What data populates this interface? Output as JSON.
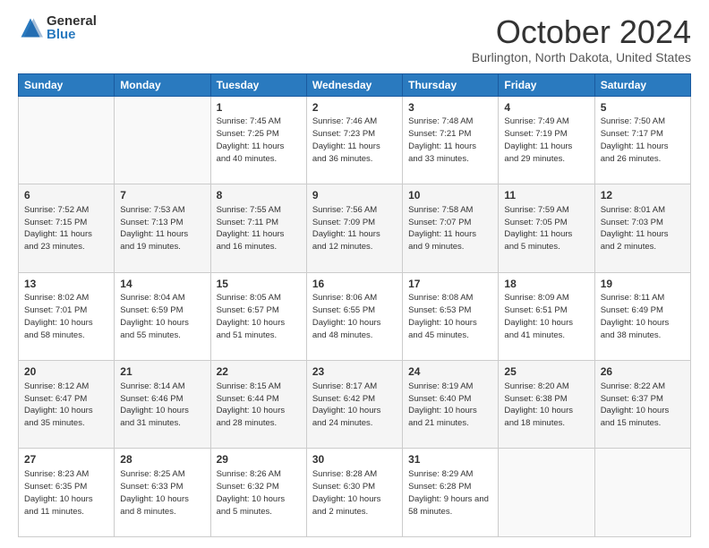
{
  "logo": {
    "general": "General",
    "blue": "Blue"
  },
  "title": "October 2024",
  "location": "Burlington, North Dakota, United States",
  "days_of_week": [
    "Sunday",
    "Monday",
    "Tuesday",
    "Wednesday",
    "Thursday",
    "Friday",
    "Saturday"
  ],
  "weeks": [
    [
      {
        "day": "",
        "info": "",
        "empty": true
      },
      {
        "day": "",
        "info": "",
        "empty": true
      },
      {
        "day": "1",
        "info": "Sunrise: 7:45 AM\nSunset: 7:25 PM\nDaylight: 11 hours and 40 minutes."
      },
      {
        "day": "2",
        "info": "Sunrise: 7:46 AM\nSunset: 7:23 PM\nDaylight: 11 hours and 36 minutes."
      },
      {
        "day": "3",
        "info": "Sunrise: 7:48 AM\nSunset: 7:21 PM\nDaylight: 11 hours and 33 minutes."
      },
      {
        "day": "4",
        "info": "Sunrise: 7:49 AM\nSunset: 7:19 PM\nDaylight: 11 hours and 29 minutes."
      },
      {
        "day": "5",
        "info": "Sunrise: 7:50 AM\nSunset: 7:17 PM\nDaylight: 11 hours and 26 minutes."
      }
    ],
    [
      {
        "day": "6",
        "info": "Sunrise: 7:52 AM\nSunset: 7:15 PM\nDaylight: 11 hours and 23 minutes."
      },
      {
        "day": "7",
        "info": "Sunrise: 7:53 AM\nSunset: 7:13 PM\nDaylight: 11 hours and 19 minutes."
      },
      {
        "day": "8",
        "info": "Sunrise: 7:55 AM\nSunset: 7:11 PM\nDaylight: 11 hours and 16 minutes."
      },
      {
        "day": "9",
        "info": "Sunrise: 7:56 AM\nSunset: 7:09 PM\nDaylight: 11 hours and 12 minutes."
      },
      {
        "day": "10",
        "info": "Sunrise: 7:58 AM\nSunset: 7:07 PM\nDaylight: 11 hours and 9 minutes."
      },
      {
        "day": "11",
        "info": "Sunrise: 7:59 AM\nSunset: 7:05 PM\nDaylight: 11 hours and 5 minutes."
      },
      {
        "day": "12",
        "info": "Sunrise: 8:01 AM\nSunset: 7:03 PM\nDaylight: 11 hours and 2 minutes."
      }
    ],
    [
      {
        "day": "13",
        "info": "Sunrise: 8:02 AM\nSunset: 7:01 PM\nDaylight: 10 hours and 58 minutes."
      },
      {
        "day": "14",
        "info": "Sunrise: 8:04 AM\nSunset: 6:59 PM\nDaylight: 10 hours and 55 minutes."
      },
      {
        "day": "15",
        "info": "Sunrise: 8:05 AM\nSunset: 6:57 PM\nDaylight: 10 hours and 51 minutes."
      },
      {
        "day": "16",
        "info": "Sunrise: 8:06 AM\nSunset: 6:55 PM\nDaylight: 10 hours and 48 minutes."
      },
      {
        "day": "17",
        "info": "Sunrise: 8:08 AM\nSunset: 6:53 PM\nDaylight: 10 hours and 45 minutes."
      },
      {
        "day": "18",
        "info": "Sunrise: 8:09 AM\nSunset: 6:51 PM\nDaylight: 10 hours and 41 minutes."
      },
      {
        "day": "19",
        "info": "Sunrise: 8:11 AM\nSunset: 6:49 PM\nDaylight: 10 hours and 38 minutes."
      }
    ],
    [
      {
        "day": "20",
        "info": "Sunrise: 8:12 AM\nSunset: 6:47 PM\nDaylight: 10 hours and 35 minutes."
      },
      {
        "day": "21",
        "info": "Sunrise: 8:14 AM\nSunset: 6:46 PM\nDaylight: 10 hours and 31 minutes."
      },
      {
        "day": "22",
        "info": "Sunrise: 8:15 AM\nSunset: 6:44 PM\nDaylight: 10 hours and 28 minutes."
      },
      {
        "day": "23",
        "info": "Sunrise: 8:17 AM\nSunset: 6:42 PM\nDaylight: 10 hours and 24 minutes."
      },
      {
        "day": "24",
        "info": "Sunrise: 8:19 AM\nSunset: 6:40 PM\nDaylight: 10 hours and 21 minutes."
      },
      {
        "day": "25",
        "info": "Sunrise: 8:20 AM\nSunset: 6:38 PM\nDaylight: 10 hours and 18 minutes."
      },
      {
        "day": "26",
        "info": "Sunrise: 8:22 AM\nSunset: 6:37 PM\nDaylight: 10 hours and 15 minutes."
      }
    ],
    [
      {
        "day": "27",
        "info": "Sunrise: 8:23 AM\nSunset: 6:35 PM\nDaylight: 10 hours and 11 minutes."
      },
      {
        "day": "28",
        "info": "Sunrise: 8:25 AM\nSunset: 6:33 PM\nDaylight: 10 hours and 8 minutes."
      },
      {
        "day": "29",
        "info": "Sunrise: 8:26 AM\nSunset: 6:32 PM\nDaylight: 10 hours and 5 minutes."
      },
      {
        "day": "30",
        "info": "Sunrise: 8:28 AM\nSunset: 6:30 PM\nDaylight: 10 hours and 2 minutes."
      },
      {
        "day": "31",
        "info": "Sunrise: 8:29 AM\nSunset: 6:28 PM\nDaylight: 9 hours and 58 minutes."
      },
      {
        "day": "",
        "info": "",
        "empty": true
      },
      {
        "day": "",
        "info": "",
        "empty": true
      }
    ]
  ]
}
